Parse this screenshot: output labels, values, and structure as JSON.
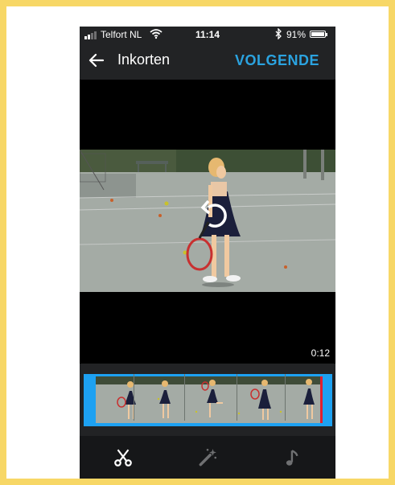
{
  "status_bar": {
    "carrier": "Telfort NL",
    "time": "11:14",
    "battery_percent": "91%",
    "signal_bars": 2,
    "battery_level": 0.91
  },
  "header": {
    "title": "Inkorten",
    "next_label": "VOLGENDE"
  },
  "video": {
    "duration": "0:12"
  },
  "colors": {
    "accent": "#2BA3E0",
    "trim_frame": "#1DA1F2",
    "trim_handle_right": "#E02030",
    "background": "#222325",
    "page_border": "#F7D766"
  },
  "toolbar": {
    "icons": [
      "scissors-icon",
      "magic-wand-icon",
      "music-note-icon"
    ],
    "active": "scissors-icon"
  }
}
